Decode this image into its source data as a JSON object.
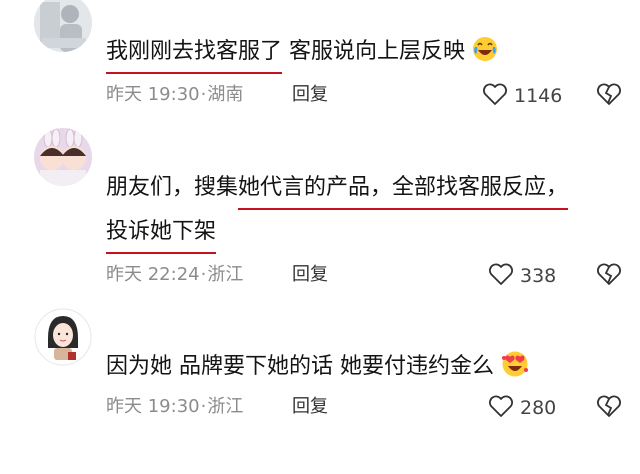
{
  "colors": {
    "underline": "#c4131c",
    "meta": "#8c8c8c",
    "text": "#141414"
  },
  "comments": [
    {
      "avatar": "avatar-photo",
      "lines": [
        {
          "a": "我刚刚去找客服了",
          "b": " 客服说向上层反映"
        }
      ],
      "emoji": "crying-laughing-face-icon",
      "time": "昨天 19:30",
      "location": "湖南",
      "reply": "回复",
      "likes": "1146"
    },
    {
      "avatar": "avatar-twins-bunny-ears",
      "lines": [
        {
          "a": "朋友们，搜集",
          "b": "她代言的产品，全部找客服反应，"
        },
        {
          "a": "投诉她下架",
          "b": ""
        }
      ],
      "time": "昨天 22:24",
      "location": "浙江",
      "reply": "回复",
      "likes": "338"
    },
    {
      "avatar": "avatar-cartoon-girl",
      "lines": [
        {
          "a": "因为她 品牌要下她的话 她要付违约金么",
          "b": ""
        }
      ],
      "emoji": "heart-eyes-face-icon",
      "time": "昨天 19:30",
      "location": "浙江",
      "reply": "回复",
      "likes": "280"
    }
  ]
}
